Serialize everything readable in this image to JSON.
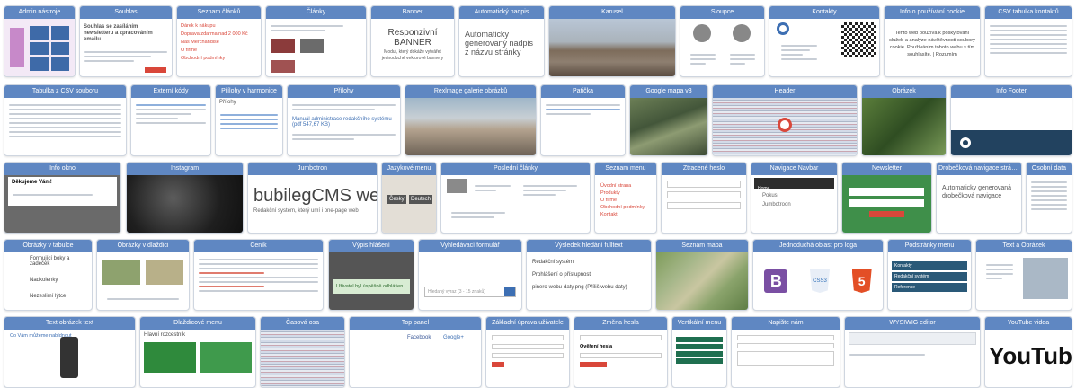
{
  "rows": [
    [
      {
        "title": "Admin nástroje"
      },
      {
        "title": "Souhlas",
        "body_text": "Souhlas se zasíláním newsletteru a zpracováním emailu"
      },
      {
        "title": "Seznam článků",
        "lines": [
          "Dárek k nákupu",
          "Doprava zdarma nad 2 000 Kč",
          "Náš Merchandise",
          "O firmě",
          "Obchodní podmínky"
        ]
      },
      {
        "title": "Články"
      },
      {
        "title": "Banner",
        "text_big": "Responzivní BANNER",
        "text_small": "Modul, který dokáže vytvářet jednoduché vektorové bannery"
      },
      {
        "title": "Automatický nadpis",
        "text_big": "Automaticky generovaný nadpis z názvu stránky"
      },
      {
        "title": "Karusel"
      },
      {
        "title": "Sloupce"
      },
      {
        "title": "Kontakty"
      },
      {
        "title": "Info o používání cookie",
        "text": "Tento web používá k poskytování služeb a analýze návštěvnosti soubory cookie. Používáním tohoto webu s tím souhlasíte. | Rozumím"
      },
      {
        "title": "CSV tabulka kontaktů"
      }
    ],
    [
      {
        "title": "Tabulka z CSV souboru"
      },
      {
        "title": "Externí kódy"
      },
      {
        "title": "Přílohy v harmonice",
        "text": "Přílohy"
      },
      {
        "title": "Přílohy",
        "text": "Manuál administrace redakčního systému (pdf 547,67 KB)"
      },
      {
        "title": "Rexlmage galerie obrázků"
      },
      {
        "title": "Patička"
      },
      {
        "title": "Google mapa v3"
      },
      {
        "title": "Header"
      },
      {
        "title": "Obrázek"
      },
      {
        "title": "Info Footer"
      }
    ],
    [
      {
        "title": "Info okno",
        "text": "Děkujeme Vám!"
      },
      {
        "title": "Instagram"
      },
      {
        "title": "Jumbotron",
        "text_big": "bubilegCMS we",
        "text_small": "Redakční systém, který umí i one-page web"
      },
      {
        "title": "Jazykové menu",
        "buttons": [
          "Česky",
          "Deutsch"
        ]
      },
      {
        "title": "Poslední články"
      },
      {
        "title": "Seznam menu",
        "lines": [
          "Úvodní strana",
          "Produkty",
          "O firmě",
          "Obchodní podmínky",
          "Kontakt"
        ]
      },
      {
        "title": "Ztracené heslo"
      },
      {
        "title": "Navigace Navbar",
        "lines": [
          "Home",
          "Pokus",
          "Jumbotroon"
        ]
      },
      {
        "title": "Newsletter"
      },
      {
        "title": "Drobečková navigace stránek",
        "text": "Automaticky generovaná drobečková navigace"
      },
      {
        "title": "Osobní data"
      }
    ],
    [
      {
        "title": "Obrázky v tabulce",
        "lines": [
          "Formující boky a zadeček",
          "Nadkolenky",
          "Nezeslimí lýtce"
        ]
      },
      {
        "title": "Obrázky v dlaždici"
      },
      {
        "title": "Ceník"
      },
      {
        "title": "Výpis hlášení",
        "text": "Uživatel byl úspěšně odhlášen."
      },
      {
        "title": "Vyhledávací formulář",
        "placeholder": "Hledaný výraz (3 - 15 znaků)"
      },
      {
        "title": "Výsledek hledání fulltext",
        "lines": [
          "Redakční systém",
          "Prohlášení o přístupnosti",
          "pinero-webu-daty.png (Příliš webu daty)"
        ]
      },
      {
        "title": "Seznam mapa"
      },
      {
        "title": "Jednoduchá oblast pro loga",
        "logos": [
          "B",
          "CSS3",
          "5"
        ]
      },
      {
        "title": "Podstránky menu",
        "lines": [
          "Kontakty",
          "Redakční systém",
          "Reference"
        ]
      },
      {
        "title": "Text a Obrázek"
      }
    ],
    [
      {
        "title": "Text obrázek text",
        "text": "Co Vám můžeme nabídnout"
      },
      {
        "title": "Dlaždicové menu",
        "text": "Hlavní rozcestník"
      },
      {
        "title": "Časová osa"
      },
      {
        "title": "Top panel",
        "lines": [
          "Facebook",
          "Google+"
        ]
      },
      {
        "title": "Základní úprava uživatele"
      },
      {
        "title": "Změna hesla",
        "text": "Ověření hesla"
      },
      {
        "title": "Vertikální menu"
      },
      {
        "title": "Napište nám"
      },
      {
        "title": "WYSIWIG editor"
      },
      {
        "title": "YouTube videa",
        "text_big": "YouTube"
      }
    ]
  ]
}
